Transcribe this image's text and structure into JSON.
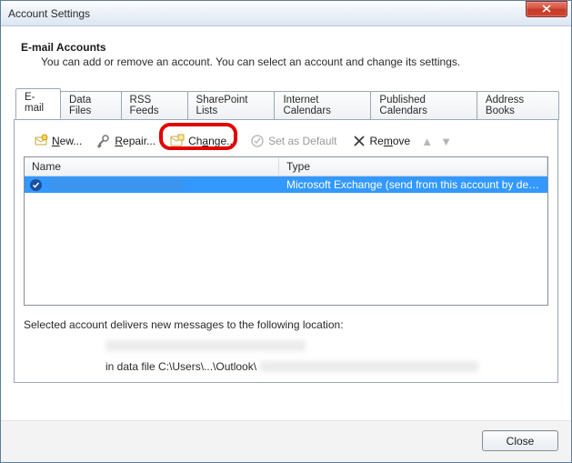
{
  "window": {
    "title": "Account Settings"
  },
  "header": {
    "heading": "E-mail Accounts",
    "sub": "You can add or remove an account. You can select an account and change its settings."
  },
  "tabs": [
    {
      "label": "E-mail",
      "active": true
    },
    {
      "label": "Data Files"
    },
    {
      "label": "RSS Feeds"
    },
    {
      "label": "SharePoint Lists"
    },
    {
      "label": "Internet Calendars"
    },
    {
      "label": "Published Calendars"
    },
    {
      "label": "Address Books"
    }
  ],
  "toolbar": {
    "new": "New...",
    "repair": "Repair...",
    "change": "Change...",
    "set_default": "Set as Default",
    "remove": "Remove"
  },
  "grid": {
    "columns": {
      "name": "Name",
      "type": "Type"
    },
    "rows": [
      {
        "name": "████████████████",
        "type": "Microsoft Exchange (send from this account by def..."
      }
    ]
  },
  "location": {
    "intro": "Selected account delivers new messages to the following location:",
    "line1": "██████████████████████████",
    "line2_prefix": "in data file C:\\Users\\...\\Outlook\\",
    "line2_blur": "███████████████████████████"
  },
  "footer": {
    "close": "Close"
  }
}
